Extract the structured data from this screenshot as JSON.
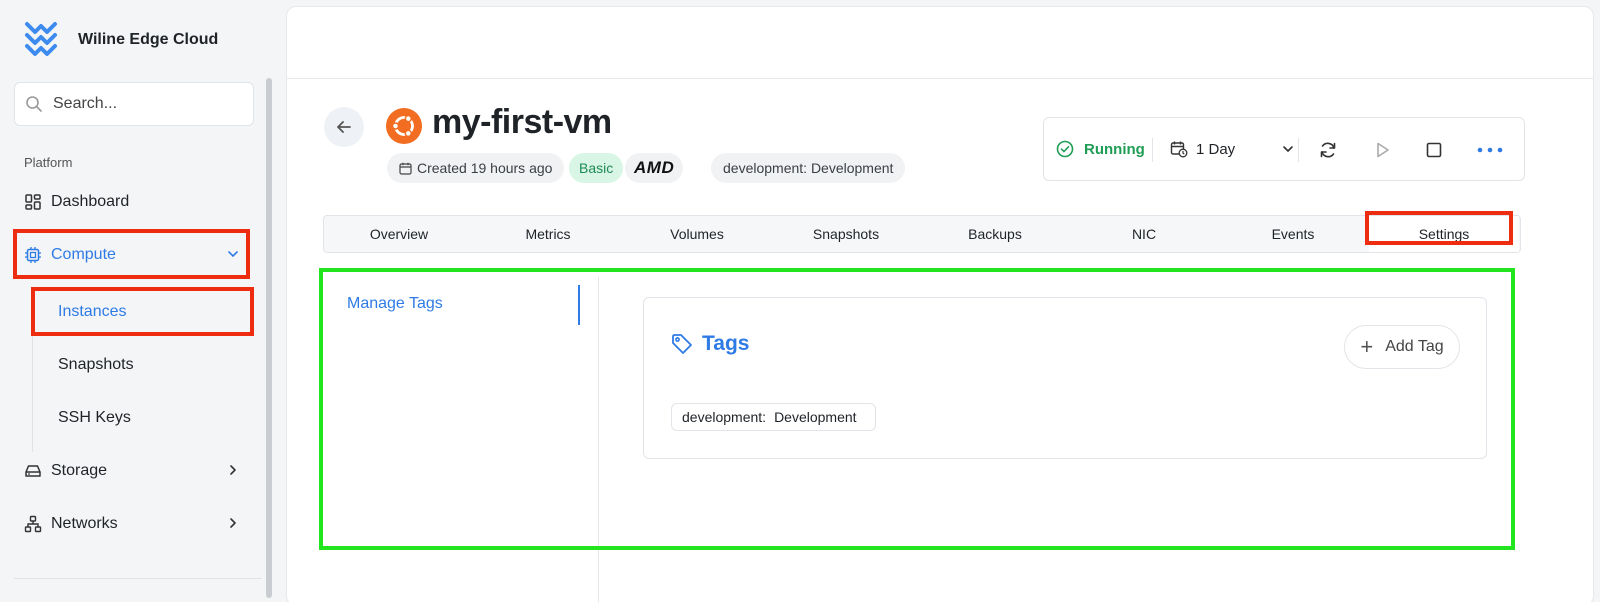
{
  "brand": {
    "name": "Wiline Edge Cloud"
  },
  "search": {
    "placeholder": "Search..."
  },
  "sidebar": {
    "section_label": "Platform",
    "items": [
      {
        "label": "Dashboard",
        "icon": "dashboard-icon"
      },
      {
        "label": "Compute",
        "icon": "cpu-icon",
        "expanded": true
      },
      {
        "label": "Storage",
        "icon": "storage-icon"
      },
      {
        "label": "Networks",
        "icon": "network-icon"
      }
    ],
    "compute_sub": [
      {
        "label": "Instances",
        "active": true
      },
      {
        "label": "Snapshots"
      },
      {
        "label": "SSH Keys"
      }
    ]
  },
  "instance": {
    "name": "my-first-vm",
    "os_icon": "ubuntu-icon",
    "created": "Created 19 hours ago",
    "plan": "Basic",
    "cpu_vendor": "AMD",
    "tag_chip": "development: Development"
  },
  "controls": {
    "status": "Running",
    "period": "1 Day",
    "status_color": "#1f9d55"
  },
  "tabs": [
    "Overview",
    "Metrics",
    "Volumes",
    "Snapshots",
    "Backups",
    "NIC",
    "Events",
    "Settings"
  ],
  "active_tab": "Settings",
  "settings": {
    "nav_item": "Manage Tags",
    "tags_title": "Tags",
    "add_tag_label": "Add Tag",
    "tags": [
      {
        "key": "development:",
        "value": "Development"
      }
    ]
  },
  "colors": {
    "accent": "#2f7be5",
    "highlight_red": "#ee2d10",
    "highlight_green": "#22e51f"
  }
}
